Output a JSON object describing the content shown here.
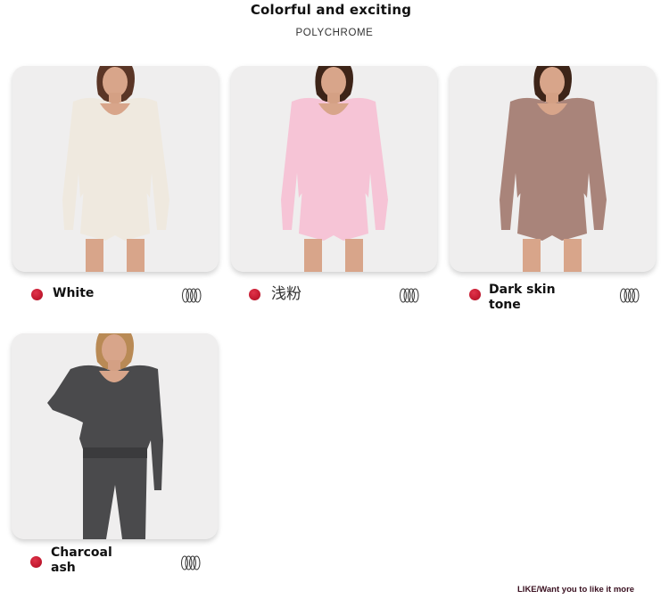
{
  "header": {
    "title": "Colorful and exciting",
    "subtitle": "POLYCHROME"
  },
  "products": [
    {
      "label": "White",
      "garment_color": "#efe9df",
      "dot_color": "#c31a30"
    },
    {
      "label": "浅粉",
      "garment_color": "#f6c4d6",
      "dot_color": "#c31a30"
    },
    {
      "label": "Dark skin tone",
      "garment_color": "#a9847a",
      "dot_color": "#c31a30"
    },
    {
      "label": "Charcoal ash",
      "garment_color": "#4a4a4c",
      "dot_color": "#c31a30"
    }
  ],
  "footer": {
    "like_text": "LIKE/Want you to like it more"
  }
}
